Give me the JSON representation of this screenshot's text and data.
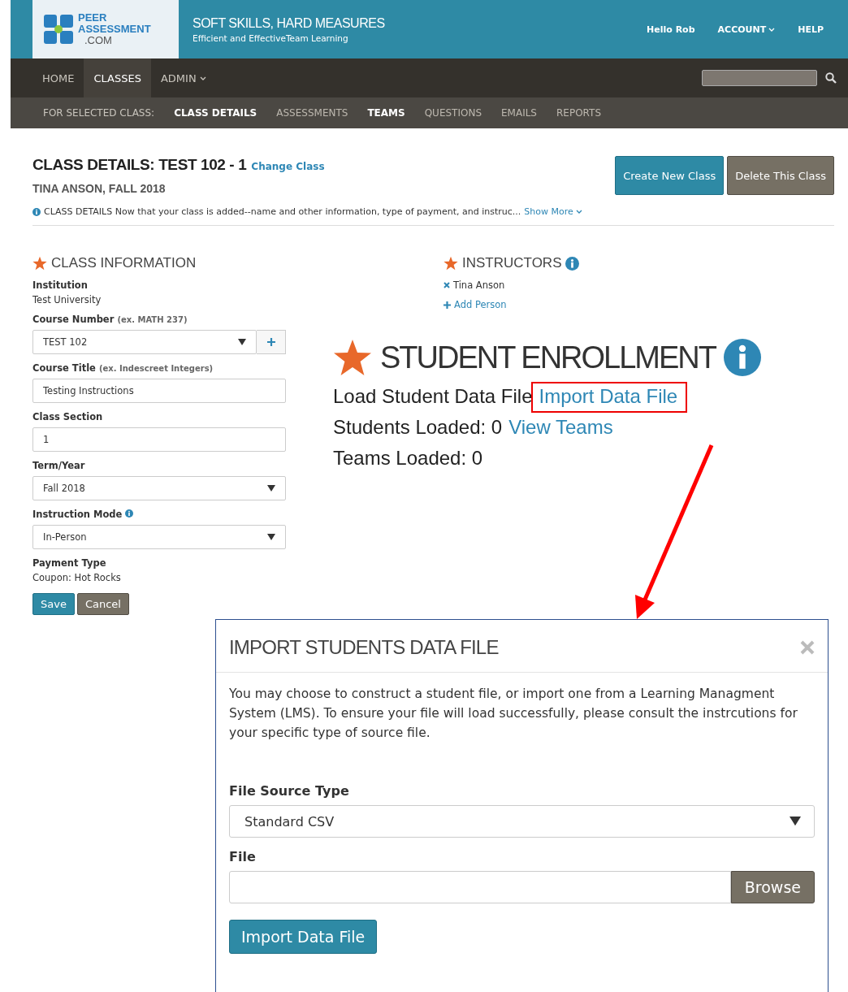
{
  "header": {
    "logo": {
      "line_1": "PEER",
      "line_2": "ASSESSMENT",
      "line_3": ".COM"
    },
    "tagline": "SOFT SKILLS, HARD MEASURES",
    "subtitle": "Efficient and EffectiveTeam Learning",
    "links": [
      {
        "label": "Hello Rob",
        "dropdown": false
      },
      {
        "label": "ACCOUNT",
        "dropdown": true
      },
      {
        "label": "HELP",
        "dropdown": false
      }
    ]
  },
  "nav": {
    "items": [
      {
        "label": "HOME",
        "selected": false,
        "dropdown": false
      },
      {
        "label": "CLASSES",
        "selected": true,
        "dropdown": false
      },
      {
        "label": "ADMIN",
        "selected": false,
        "dropdown": true
      }
    ]
  },
  "subnav": {
    "label": "FOR SELECTED CLASS:",
    "items": [
      {
        "label": "CLASS DETAILS",
        "selected": true
      },
      {
        "label": "ASSESSMENTS",
        "selected": false
      },
      {
        "label": "TEAMS",
        "selected": true
      },
      {
        "label": "QUESTIONS",
        "selected": false
      },
      {
        "label": "EMAILS",
        "selected": false
      },
      {
        "label": "REPORTS",
        "selected": false
      }
    ]
  },
  "page": {
    "title": "CLASS DETAILS: TEST 102 - 1",
    "change_link": "Change Class",
    "subtitle": "TINA ANSON, FALL 2018",
    "buttons": [
      {
        "label": "Create New Class",
        "kind": "primary"
      },
      {
        "label": "Delete This Class",
        "kind": "secondary"
      }
    ],
    "notice": {
      "text": "CLASS DETAILS Now that your class is added--name and other information, type of payment, and instruc...",
      "link": "Show More"
    }
  },
  "class_information": {
    "title": "CLASS INFORMATION",
    "fields": [
      {
        "kind": "static",
        "label": "Institution",
        "value": "Test University"
      },
      {
        "kind": "select_add",
        "label": "Course Number",
        "hint": "(ex. MATH 237)",
        "value": "TEST 102"
      },
      {
        "kind": "text",
        "label": "Course Title",
        "hint": "(ex. Indescreet Integers)",
        "value": "Testing Instructions"
      },
      {
        "kind": "text",
        "label": "Class Section",
        "value": "1"
      },
      {
        "kind": "select",
        "label": "Term/Year",
        "value": "Fall 2018"
      },
      {
        "kind": "select",
        "label": "Instruction Mode",
        "info": true,
        "value": "In-Person"
      },
      {
        "kind": "static",
        "label": "Payment Type",
        "value": "Coupon: Hot Rocks"
      }
    ],
    "buttons": [
      {
        "label": "Save",
        "kind": "primary"
      },
      {
        "label": "Cancel",
        "kind": "secondary"
      }
    ]
  },
  "instructors": {
    "title": "INSTRUCTORS",
    "people": [
      "Tina Anson"
    ],
    "add_link": "Add Person"
  },
  "student_enrollment": {
    "title": "STUDENT ENROLLMENT",
    "rows": [
      {
        "label": "Load Student Data File",
        "link": "Import Data File",
        "highlighted": true
      },
      {
        "label": "Students Loaded: 0",
        "link": "View Teams",
        "highlighted": false
      },
      {
        "label": "Teams Loaded: 0"
      }
    ]
  },
  "modal": {
    "title": "IMPORT STUDENTS DATA FILE",
    "description": "You may choose to construct a student file, or import one from a Learning Managment System (LMS). To ensure your file will load successfully, please consult the instrcutions for your specific type of source file.",
    "fields": [
      {
        "kind": "select",
        "label": "File Source Type",
        "value": "Standard CSV"
      },
      {
        "kind": "file",
        "label": "File",
        "button": "Browse"
      }
    ],
    "submit": "Import Data File"
  }
}
